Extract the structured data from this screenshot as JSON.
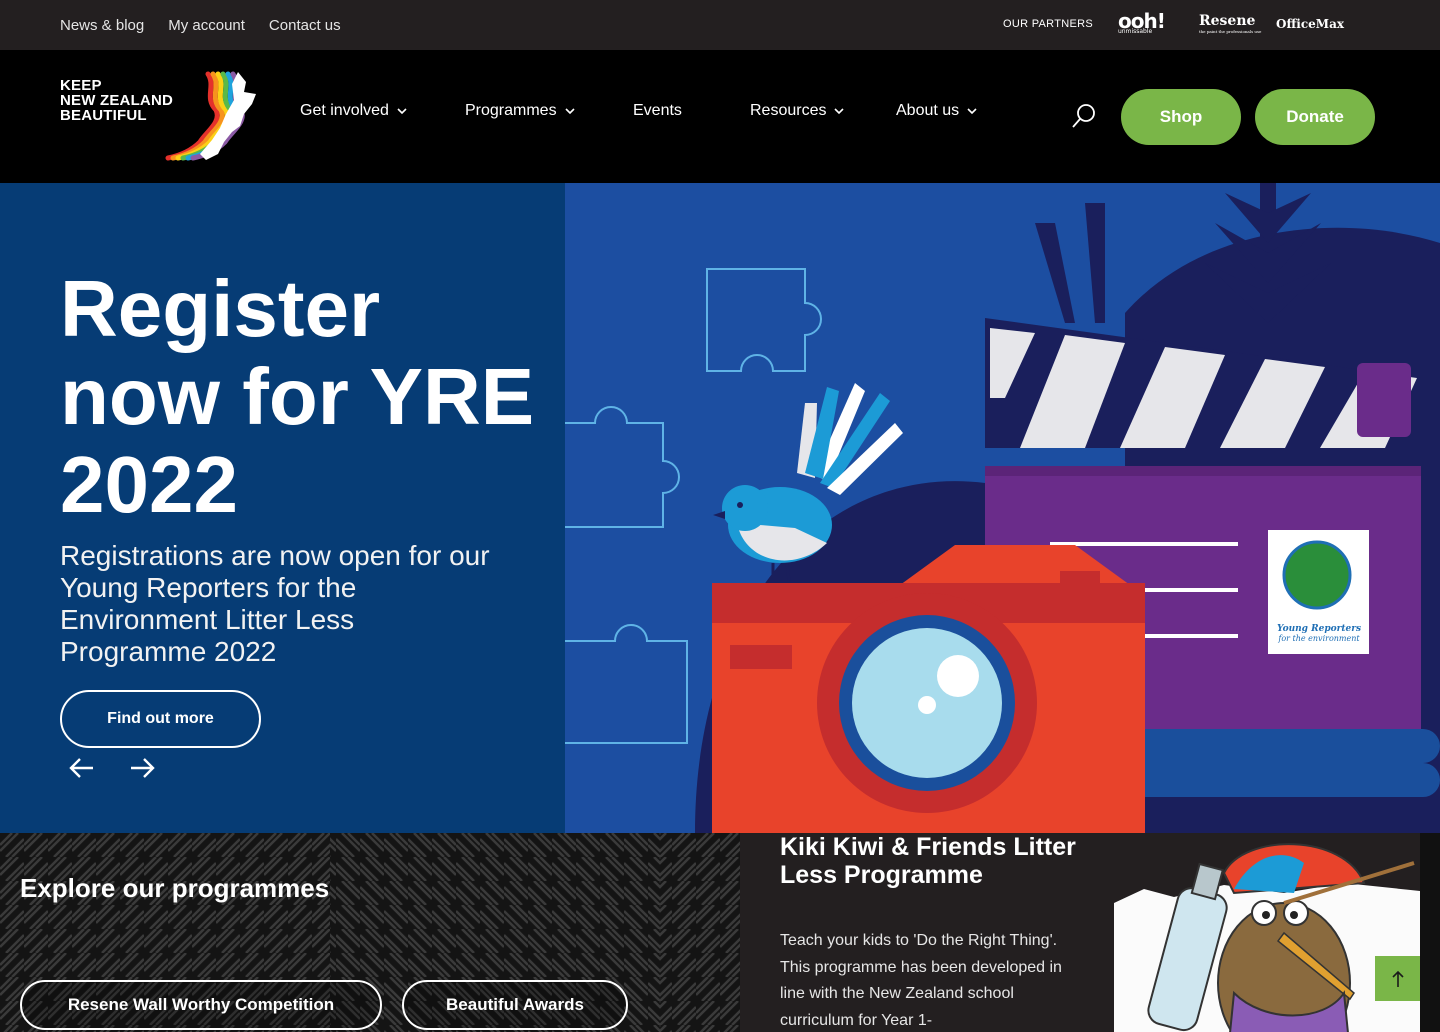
{
  "utility_nav": {
    "links": [
      "News & blog",
      "My account",
      "Contact us"
    ],
    "partners_label": "OUR PARTNERS",
    "partners": [
      "ooh!",
      "Resene",
      "OfficeMax"
    ],
    "ooh_tagline": "unmissable",
    "resene_tagline": "the paint the professionals use"
  },
  "header": {
    "logo_lines": [
      "KEEP",
      "NEW ZEALAND",
      "BEAUTIFUL"
    ],
    "nav": [
      "Get involved",
      "Programmes",
      "Events",
      "Resources",
      "About us"
    ],
    "shop_label": "Shop",
    "donate_label": "Donate"
  },
  "hero": {
    "title": "Register now for YRE 2022",
    "subtitle": "Registrations are now open for our Young Reporters for the Environment Litter Less Programme 2022",
    "cta": "Find out more",
    "badge_text": [
      "Young Reporters",
      "for the environment"
    ]
  },
  "programmes": {
    "title": "Explore our programmes",
    "pills": [
      "Resene Wall Worthy Competition",
      "Beautiful Awards"
    ]
  },
  "card": {
    "title": "Kiki Kiwi & Friends Litter Less Programme",
    "text": "Teach your kids to 'Do the Right Thing'. This programme has been developed in line with the New Zealand school curriculum for Year 1-"
  },
  "colors": {
    "green": "#7ab648",
    "hero_blue": "#063c75",
    "illustration_blue": "#1c4ea1",
    "purple": "#6a2c8a",
    "camera_red": "#e8432b"
  }
}
